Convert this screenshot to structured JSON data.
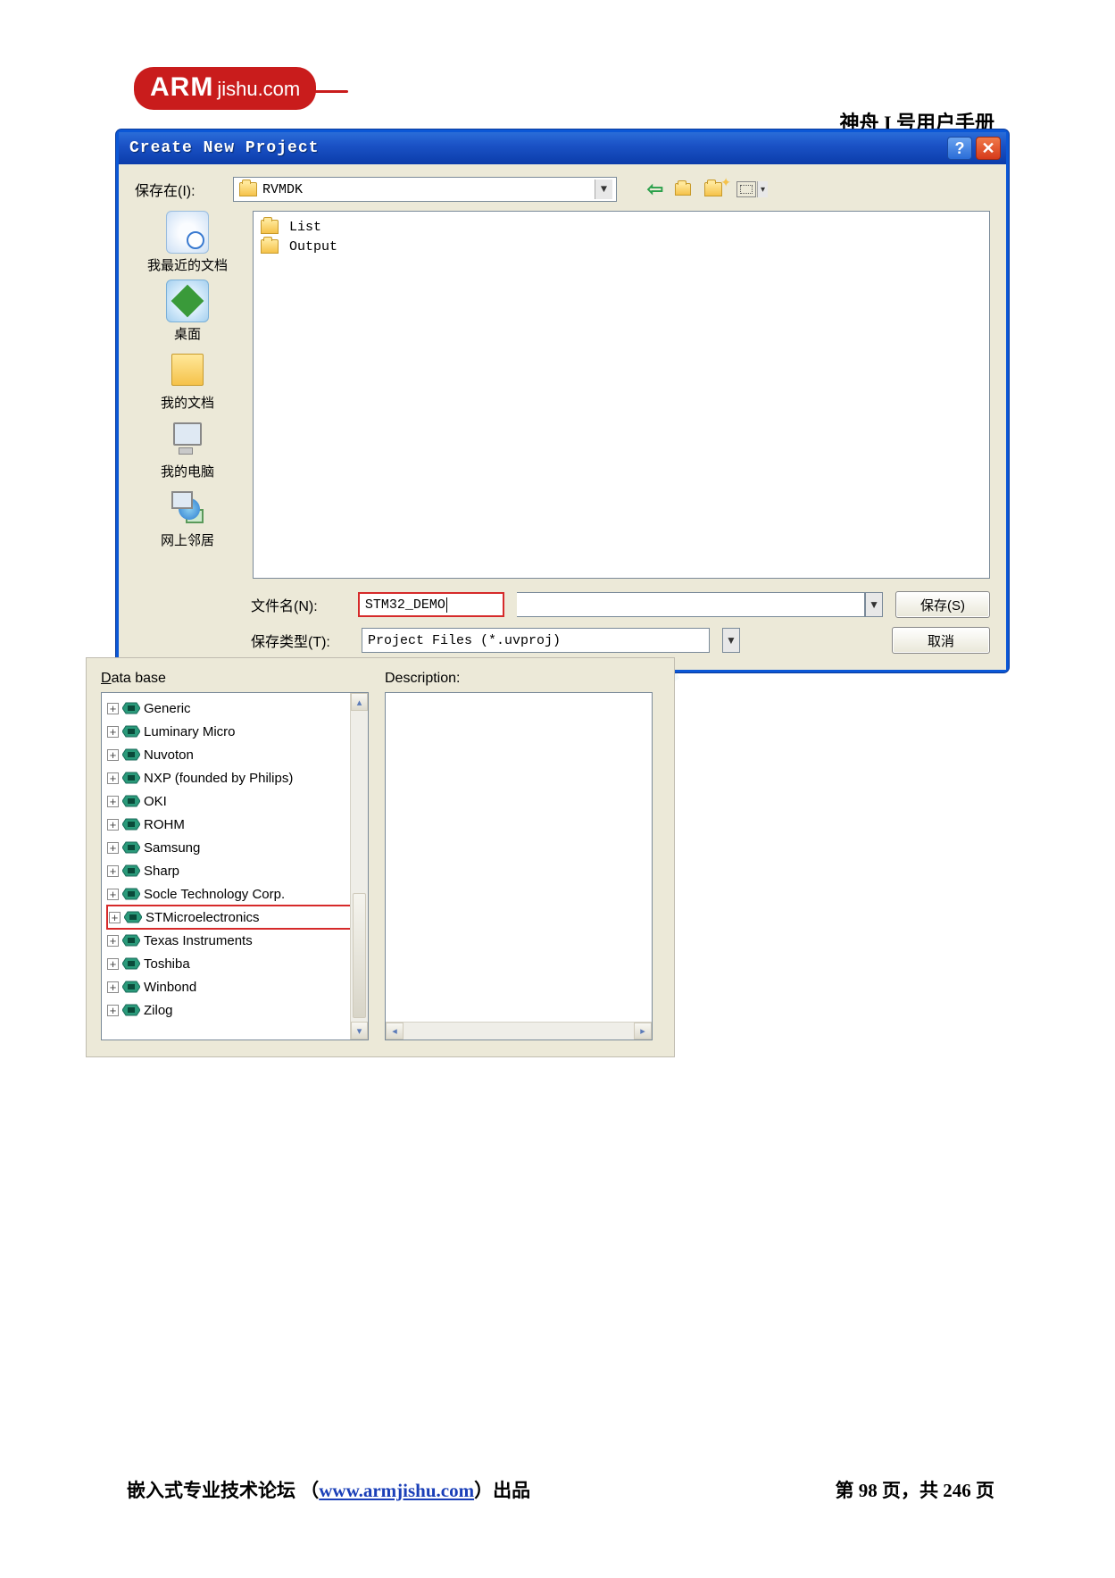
{
  "logo": {
    "arm": "ARM",
    "jishu": "jishu.com"
  },
  "doc_title": "神舟 I 号用户手册",
  "dialog": {
    "title": "Create New Project",
    "save_in_label": "保存在(I):",
    "save_in_value": "RVMDK",
    "places": {
      "recent": "我最近的文档",
      "desktop": "桌面",
      "docs": "我的文档",
      "computer": "我的电脑",
      "network": "网上邻居"
    },
    "files": [
      {
        "name": "List"
      },
      {
        "name": "Output"
      }
    ],
    "filename_label": "文件名(N):",
    "filename_value": "STM32_DEMO",
    "filetype_label": "保存类型(T):",
    "filetype_value": "Project Files (*.uvproj)",
    "save_btn": "保存(S)",
    "cancel_btn": "取消"
  },
  "db": {
    "label": "Data base",
    "desc_label": "Description:",
    "items": [
      "Generic",
      "Luminary Micro",
      "Nuvoton",
      "NXP (founded by Philips)",
      "OKI",
      "ROHM",
      "Samsung",
      "Sharp",
      "Socle Technology Corp.",
      "STMicroelectronics",
      "Texas Instruments",
      "Toshiba",
      "Winbond",
      "Zilog"
    ],
    "highlight_index": 9
  },
  "footer": {
    "left_prefix": "嵌入式专业技术论坛 （",
    "link": "www.armjishu.com",
    "left_suffix": "）出品",
    "right": "第 98 页，共 246 页"
  }
}
